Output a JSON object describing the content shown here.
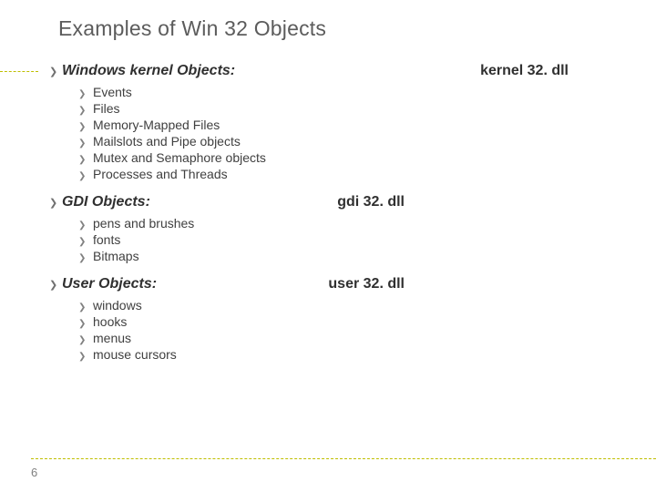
{
  "title": "Examples of Win 32 Objects",
  "page_number": "6",
  "sections": [
    {
      "heading": "Windows kernel Objects:",
      "dll": "kernel 32. dll",
      "items": [
        "Events",
        "Files",
        "Memory-Mapped Files",
        "Mailslots and Pipe objects",
        "Mutex and Semaphore objects",
        "Processes and Threads"
      ]
    },
    {
      "heading": "GDI Objects:",
      "dll": "gdi 32. dll",
      "items": [
        "pens and brushes",
        "fonts",
        "Bitmaps"
      ]
    },
    {
      "heading": "User Objects:",
      "dll": "user 32. dll",
      "items": [
        "windows",
        "hooks",
        "menus",
        "mouse cursors"
      ]
    }
  ]
}
